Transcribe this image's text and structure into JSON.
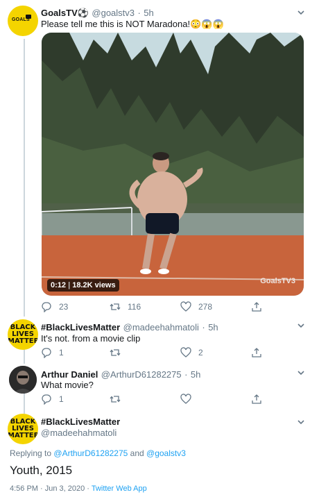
{
  "tweet1": {
    "avatar_text": "GOALS",
    "name": "GoalsTV⚽",
    "handle": "@goalstv3",
    "time": "5h",
    "text": "Please tell me this is NOT Maradona!😳😱😱",
    "video": {
      "duration": "0:12",
      "views": "18.2K views",
      "watermark": "GoalsTV3"
    },
    "replies": "23",
    "retweets": "116",
    "likes": "278"
  },
  "tweet2": {
    "avatar_text": [
      "BLACK",
      "LIVES",
      "MATTER"
    ],
    "name": "#BlackLivesMatter",
    "handle": "@madeehahmatoli",
    "time": "5h",
    "text": "It's not. from a movie clip",
    "replies": "1",
    "retweets": "",
    "likes": "2"
  },
  "tweet3": {
    "name": "Arthur Daniel",
    "handle": "@ArthurD61282275",
    "time": "5h",
    "text": "What movie?",
    "replies": "1",
    "retweets": "",
    "likes": ""
  },
  "main": {
    "avatar_text": [
      "BLACK",
      "LIVES",
      "MATTER"
    ],
    "name": "#BlackLivesMatter",
    "handle": "@madeehahmatoli",
    "replying_prefix": "Replying to",
    "replying_user1": "@ArthurD61282275",
    "replying_and": "and",
    "replying_user2": "@goalstv3",
    "text": "Youth, 2015",
    "timestamp": "4:56 PM · Jun 3, 2020 ·",
    "source": "Twitter Web App"
  },
  "icons": {
    "reply": "reply-icon",
    "retweet": "retweet-icon",
    "like": "heart-icon",
    "share": "share-icon",
    "more": "chevron-down-icon"
  },
  "colors": {
    "link": "#1da1f2",
    "secondary_text": "#657786",
    "avatar_yellow": "#f4d400",
    "court_clay": "#c8643c"
  }
}
